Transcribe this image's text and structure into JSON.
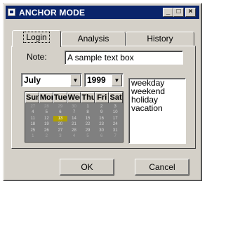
{
  "window": {
    "title": "ANCHOR MODE",
    "minimize": "_",
    "maximize": "□",
    "close": "×"
  },
  "tabs": [
    {
      "label": "Login",
      "active": true
    },
    {
      "label": "Analysis",
      "active": false
    },
    {
      "label": "History",
      "active": false
    }
  ],
  "form": {
    "note_label": "Note:",
    "note_value": "A sample text box",
    "month_value": "July",
    "year_value": "1999"
  },
  "calendar": {
    "weekdays": [
      "Sun",
      "Mon",
      "Tue",
      "Wed",
      "Thu",
      "Fri",
      "Sat"
    ],
    "days": [
      "27",
      "28",
      "29",
      "30",
      "1",
      "2",
      "3",
      "4",
      "5",
      "6",
      "7",
      "8",
      "9",
      "10",
      "11",
      "12",
      "13",
      "14",
      "15",
      "16",
      "17",
      "18",
      "19",
      "20",
      "21",
      "22",
      "23",
      "24",
      "25",
      "26",
      "27",
      "28",
      "29",
      "30",
      "31",
      "1",
      "2",
      "3",
      "4",
      "5",
      "6",
      "7"
    ],
    "selected_day": "13"
  },
  "listbox": {
    "items": [
      "weekday",
      "weekend",
      "holiday",
      "vacation"
    ]
  },
  "buttons": {
    "ok": "OK",
    "cancel": "Cancel"
  },
  "colors": {
    "titlebar": "#0a246a",
    "face": "#d4d0c8",
    "calendar_bg": "#808080"
  }
}
